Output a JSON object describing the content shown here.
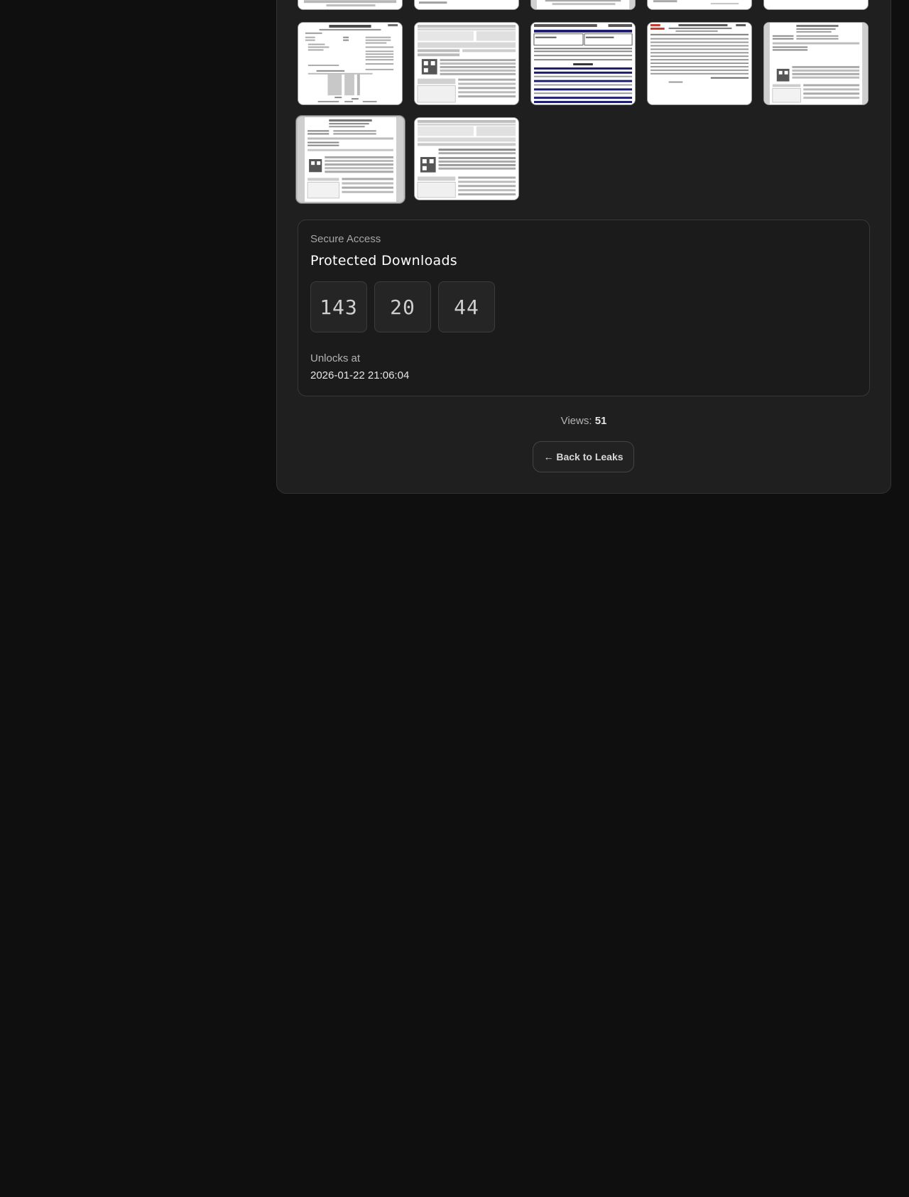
{
  "gallery": {
    "thumbnails": [
      {
        "name": "document-thumbnail-1"
      },
      {
        "name": "document-thumbnail-2"
      },
      {
        "name": "document-thumbnail-3"
      },
      {
        "name": "document-thumbnail-4"
      },
      {
        "name": "document-thumbnail-5"
      },
      {
        "name": "document-thumbnail-6"
      },
      {
        "name": "document-thumbnail-7"
      },
      {
        "name": "document-thumbnail-8"
      },
      {
        "name": "document-thumbnail-9"
      },
      {
        "name": "document-thumbnail-10"
      },
      {
        "name": "document-thumbnail-11"
      },
      {
        "name": "document-thumbnail-12"
      }
    ]
  },
  "secure": {
    "eyebrow": "Secure Access",
    "title": "Protected Downloads",
    "counters": [
      "143",
      "20",
      "44"
    ],
    "unlock_label": "Unlocks at",
    "unlock_value": "2026-01-22 21:06:04"
  },
  "stats": {
    "views_label": "Views:",
    "views_value": "51"
  },
  "nav": {
    "back_label": "← Back to Leaks"
  },
  "colors": {
    "page_bg": "#0f0f0f",
    "panel_bg": "#1f1f1f",
    "card_bg": "#1b1b1b"
  }
}
